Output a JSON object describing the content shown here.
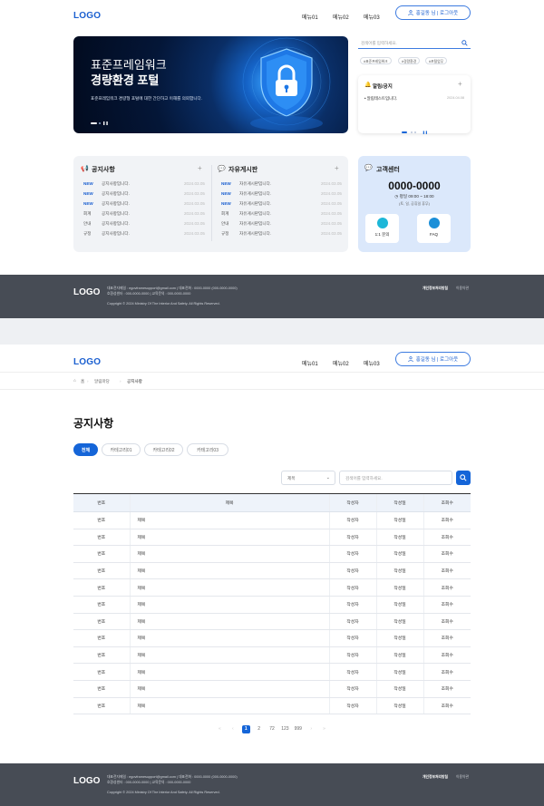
{
  "header": {
    "logo": "LOGO",
    "nav": [
      "메뉴01",
      "메뉴02",
      "메뉴03"
    ],
    "login": "홍길동 님 | 로그아웃"
  },
  "hero": {
    "title1": "표준프레임워크",
    "title2": "경량환경 포털",
    "desc": "표준프레임워크 경량형 포털에 대한 간단하고 이해를 의뢰합니다."
  },
  "search": {
    "placeholder": "검색어를 입력하세요.",
    "tags": [
      "#표준프레임워크",
      "#경량환경",
      "#포털업무"
    ]
  },
  "notice_card": {
    "title": "알림/공지",
    "item": "알림테스트입니다.",
    "date": "2024.04.08"
  },
  "notice_board": {
    "title": "공지사항",
    "rows": [
      {
        "badge": "NEW",
        "text": "공지사항입니다.",
        "date": "2024.03.05"
      },
      {
        "badge": "NEW",
        "text": "공지사항입니다.",
        "date": "2024.03.05"
      },
      {
        "badge": "NEW",
        "text": "공지사항입니다.",
        "date": "2024.03.05"
      },
      {
        "badge": "회계",
        "text": "공지사항입니다.",
        "date": "2024.03.05"
      },
      {
        "badge": "안내",
        "text": "공지사항입니다.",
        "date": "2024.03.05"
      },
      {
        "badge": "규정",
        "text": "공지사항입니다.",
        "date": "2024.03.05"
      }
    ]
  },
  "free_board": {
    "title": "자유게시판",
    "rows": [
      {
        "badge": "NEW",
        "text": "자유게시판입니다.",
        "date": "2024.03.05"
      },
      {
        "badge": "NEW",
        "text": "자유게시판입니다.",
        "date": "2024.03.05"
      },
      {
        "badge": "NEW",
        "text": "자유게시판입니다.",
        "date": "2024.03.05"
      },
      {
        "badge": "회계",
        "text": "자유게시판입니다.",
        "date": "2024.03.05"
      },
      {
        "badge": "안내",
        "text": "자유게시판입니다.",
        "date": "2024.03.05"
      },
      {
        "badge": "규정",
        "text": "자유게시판입니다.",
        "date": "2024.03.05"
      }
    ]
  },
  "customer": {
    "title": "고객센터",
    "phone": "0000-0000",
    "hours": "평일 09:00 ~ 18:00",
    "hours_note": "(토, 일, 공휴일 휴무)",
    "btn1": "1:1 문의",
    "btn2": "FAQ"
  },
  "footer": {
    "logo": "LOGO",
    "line1": "대표전자메일 : egovframesupport@gmail.com  |  대표전화 : 0000-0000 (000-0000-0000)",
    "line2": "호환성센터 : 000-0000-0000  |  교육문의 : 000-0000-0000",
    "copy": "Copyright © 2024 Ministry Of The Interior And Safety. All Rights Reserved.",
    "link1": "개인정보처리방침",
    "link2": "이용약관"
  },
  "breadcrumb": {
    "home": "홈",
    "depth1": "알림마당",
    "depth2": "공지사항"
  },
  "board": {
    "title": "공지사항",
    "tabs": [
      "전체",
      "카테고리01",
      "카테고리02",
      "카테고리03"
    ],
    "select": "제목",
    "placeholder": "검색어를 입력하세요.",
    "columns": [
      "번호",
      "제목",
      "작성자",
      "작성일",
      "조회수"
    ],
    "rows": [
      [
        "번호",
        "제목",
        "작성자",
        "작성일",
        "조회수"
      ],
      [
        "번호",
        "제목",
        "작성자",
        "작성일",
        "조회수"
      ],
      [
        "번호",
        "제목",
        "작성자",
        "작성일",
        "조회수"
      ],
      [
        "번호",
        "제목",
        "작성자",
        "작성일",
        "조회수"
      ],
      [
        "번호",
        "제목",
        "작성자",
        "작성일",
        "조회수"
      ],
      [
        "번호",
        "제목",
        "작성자",
        "작성일",
        "조회수"
      ],
      [
        "번호",
        "제목",
        "작성자",
        "작성일",
        "조회수"
      ],
      [
        "번호",
        "제목",
        "작성자",
        "작성일",
        "조회수"
      ],
      [
        "번호",
        "제목",
        "작성자",
        "작성일",
        "조회수"
      ],
      [
        "번호",
        "제목",
        "작성자",
        "작성일",
        "조회수"
      ],
      [
        "번호",
        "제목",
        "작성자",
        "작성일",
        "조회수"
      ],
      [
        "번호",
        "제목",
        "작성자",
        "작성일",
        "조회수"
      ]
    ]
  },
  "pagination": {
    "prev": [
      "«",
      "‹"
    ],
    "pages": [
      "1",
      "2",
      "72",
      "123",
      "999"
    ],
    "next": [
      "›",
      "»"
    ],
    "current": "1"
  },
  "colors": {
    "primary": "#1565d8",
    "footer": "#474c55"
  }
}
